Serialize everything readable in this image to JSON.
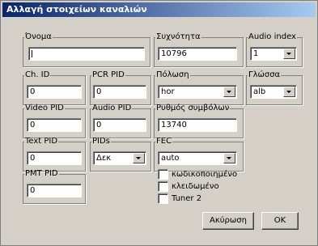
{
  "window": {
    "title": "Αλλαγή στοιχείων καναλιών"
  },
  "fields": {
    "name": {
      "label": "Όνομα",
      "value": ""
    },
    "frequency": {
      "label": "Συχνότητα",
      "value": "10796"
    },
    "audio_index": {
      "label": "Audio index",
      "value": "1"
    },
    "ch_id": {
      "label": "Ch. ID",
      "value": "0"
    },
    "pcr_pid": {
      "label": "PCR PID",
      "value": "0"
    },
    "polarization": {
      "label": "Πόλωση",
      "value": "hor"
    },
    "language": {
      "label": "Γλώσσα",
      "value": "alb"
    },
    "video_pid": {
      "label": "Video PID",
      "value": "0"
    },
    "audio_pid": {
      "label": "Audio PID",
      "value": "0"
    },
    "symbol_rate": {
      "label": "Ρυθμός συμβόλων",
      "value": "13740"
    },
    "text_pid": {
      "label": "Text PID",
      "value": "0"
    },
    "pids": {
      "label": "PIDs",
      "value": "Δεκ"
    },
    "fec": {
      "label": "FEC",
      "value": "auto"
    },
    "pmt_pid": {
      "label": "PMT PID",
      "value": "0"
    }
  },
  "checkboxes": {
    "encrypted": {
      "label": "κωδικοποιημένο",
      "checked": false
    },
    "locked": {
      "label": "κλειδωμένο",
      "checked": false
    },
    "tuner2": {
      "label": "Tuner 2",
      "checked": false
    }
  },
  "buttons": {
    "cancel": "Ακύρωση",
    "ok": "OK"
  },
  "colors": {
    "titlebar_start": "#0a246a",
    "titlebar_end": "#a6caf0",
    "dialog_bg": "#d4d0c8"
  }
}
